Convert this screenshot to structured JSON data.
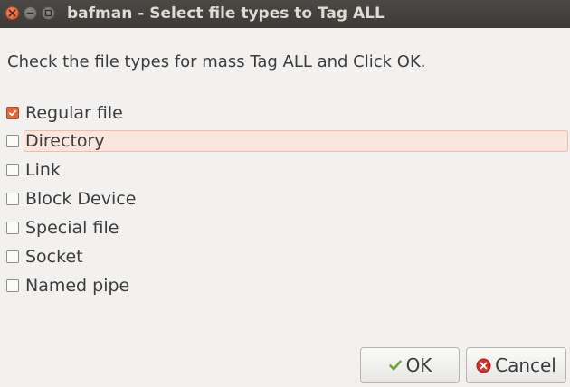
{
  "window": {
    "title": "bafman - Select file types to Tag ALL"
  },
  "instruction": "Check the file types for mass Tag ALL and Click OK.",
  "options": [
    {
      "label": "Regular file",
      "checked": true
    },
    {
      "label": "Directory",
      "checked": false
    },
    {
      "label": "Link",
      "checked": false
    },
    {
      "label": "Block Device",
      "checked": false
    },
    {
      "label": "Special file",
      "checked": false
    },
    {
      "label": "Socket",
      "checked": false
    },
    {
      "label": "Named pipe",
      "checked": false
    }
  ],
  "buttons": {
    "ok_label": "OK",
    "ok_icon": "checkmark-icon",
    "cancel_label": "Cancel",
    "cancel_icon": "cancel-icon"
  },
  "colors": {
    "accent": "#e0673c",
    "titlebar": "#3c3b37",
    "hover_bg": "#f8e6df",
    "ok_check": "#6aa436",
    "cancel_red": "#d52e2e"
  }
}
